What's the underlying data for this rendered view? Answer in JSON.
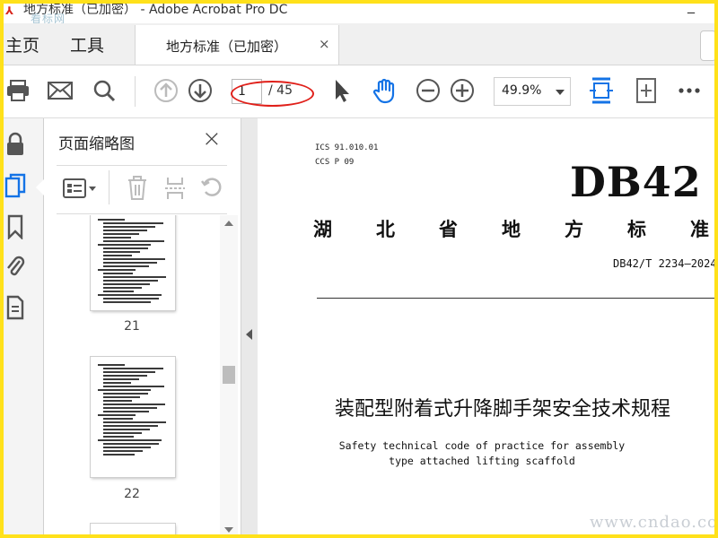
{
  "window": {
    "title": "地方标准（已加密） - Adobe Acrobat Pro DC",
    "minimize_glyph": "_",
    "watermark": "看标网"
  },
  "menu": {
    "home": "主页",
    "tools": "工具"
  },
  "tab": {
    "label": "地方标准（已加密）",
    "close": "×"
  },
  "toolbar": {
    "current_page": "1",
    "page_total": "/ 45",
    "zoom": "49.9%",
    "icons": [
      "print-icon",
      "email-icon",
      "search-icon",
      "page-up-icon",
      "page-down-icon",
      "select-cursor-icon",
      "hand-tool-icon",
      "zoom-out-icon",
      "zoom-in-icon",
      "fit-width-icon",
      "full-screen-icon",
      "more-icon"
    ],
    "accent": "#1473e6",
    "highlight_color": "#e0201a"
  },
  "rail": {
    "icons": [
      "lock-icon",
      "page-thumbnails-icon",
      "bookmark-icon",
      "attachment-icon",
      "document-icon"
    ]
  },
  "thumbnails_panel": {
    "title": "页面缩略图",
    "close": "×",
    "tools": [
      "thumbnail-options-icon",
      "delete-page-icon",
      "insert-page-icon",
      "undo-icon"
    ],
    "pages": [
      {
        "label": "21"
      },
      {
        "label": "22"
      }
    ]
  },
  "document": {
    "ics": "ICS  91.010.01",
    "ccs": "CCS  P 09",
    "code": "DB42",
    "province": "湖北省地方标准",
    "number": "DB42/T 2234—2024",
    "title_cn": "装配型附着式升降脚手架安全技术规程",
    "title_en_line1": "Safety technical code of practice for assembly",
    "title_en_line2": "type attached lifting scaffold"
  },
  "watermark_bottom": "www.cndao.com"
}
